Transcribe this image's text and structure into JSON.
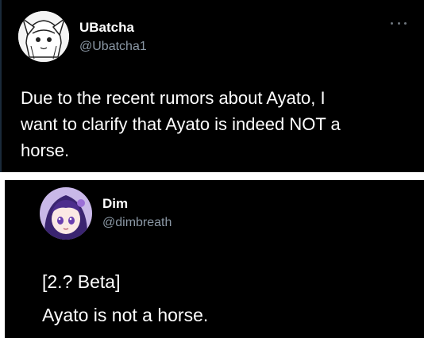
{
  "tweets": [
    {
      "display_name": "UBatcha",
      "handle": "@Ubatcha1",
      "text": "Due to the recent rumors about Ayato, I\nwant to clarify that Ayato is indeed NOT a\nhorse.",
      "more_icon": "more-horizontal-icon"
    },
    {
      "display_name": "Dim",
      "handle": "@dimbreath",
      "lines": [
        "[2.? Beta]",
        "Ayato is not a horse."
      ]
    }
  ],
  "colors": {
    "background": "#000000",
    "text": "#ffffff",
    "handle": "#8b98a5",
    "separator": "#ffffff"
  }
}
